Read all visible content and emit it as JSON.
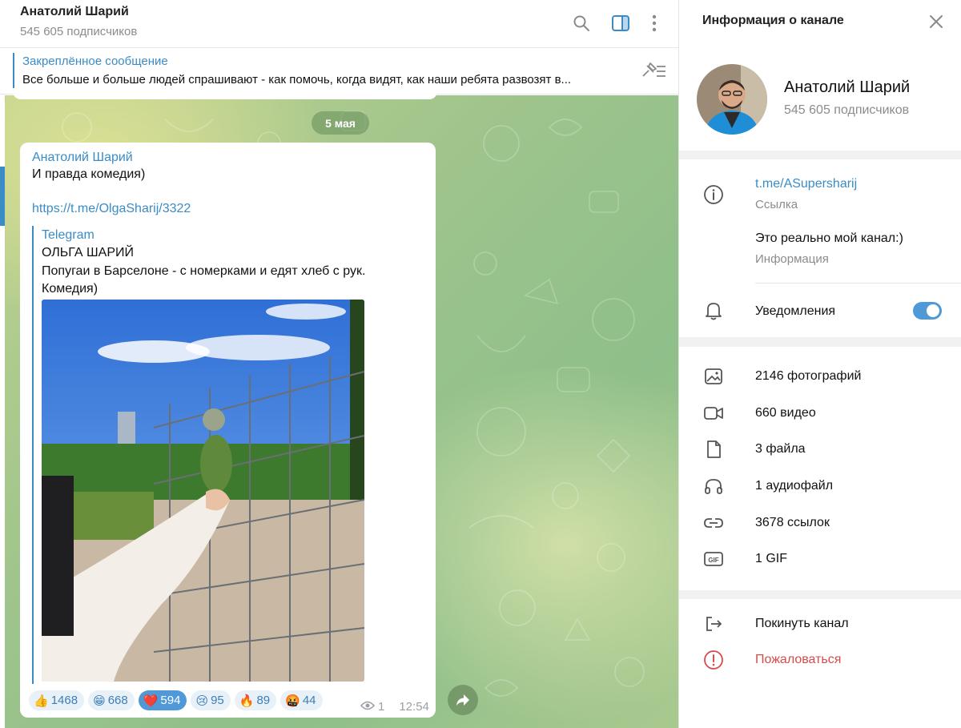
{
  "chat": {
    "title": "Анатолий Шарий",
    "subscribers": "545 605 подписчиков",
    "pinned_title": "Закреплённое сообщение",
    "pinned_text": "Все больше и больше людей спрашивают - как помочь, когда видят, как наши ребята развозят в..."
  },
  "date_label": "5 мая",
  "message": {
    "author": "Анатолий Шарий",
    "text": "И правда комедия)",
    "link": "https://t.me/OlgaSharij/3322",
    "preview_site": "Telegram",
    "preview_title": "ОЛЬГА ШАРИЙ",
    "preview_desc": "Попугаи в Барселоне - с номерками и едят хлеб с рук. Комедия)",
    "reactions": [
      {
        "emoji": "👍",
        "count": "1468",
        "active": false
      },
      {
        "emoji": "😁",
        "count": "668",
        "active": false
      },
      {
        "emoji": "❤️",
        "count": "594",
        "active": true
      },
      {
        "emoji": "😢",
        "count": "95",
        "active": false
      },
      {
        "emoji": "🔥",
        "count": "89",
        "active": false
      },
      {
        "emoji": "🤬",
        "count": "44",
        "active": false
      }
    ],
    "views": "1",
    "time": "12:54"
  },
  "panel": {
    "title": "Информация о канале",
    "channel_name": "Анатолий Шарий",
    "subscribers": "545 605 подписчиков",
    "link": "t.me/ASupersharij",
    "link_label": "Ссылка",
    "about": "Это реально мой канал:)",
    "about_label": "Информация",
    "notifications": "Уведомления",
    "notifications_on": true,
    "media": {
      "photos": "2146 фотографий",
      "videos": "660 видео",
      "files": "3 файла",
      "audio": "1 аудиофайл",
      "links": "3678 ссылок",
      "gifs": "1 GIF"
    },
    "gif_icon_text": "GIF",
    "leave": "Покинуть канал",
    "report": "Пожаловаться"
  }
}
